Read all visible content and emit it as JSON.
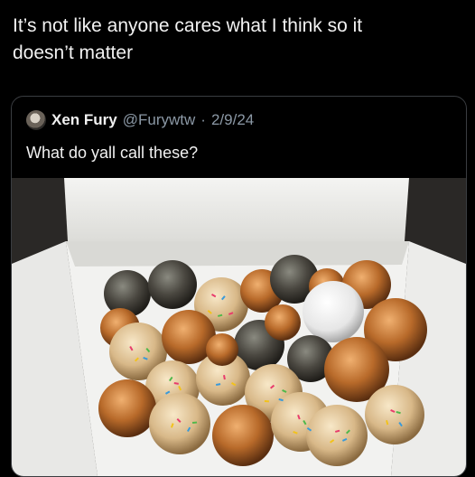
{
  "post": {
    "text": "It’s not like anyone cares what I think so it\ndoesn’t matter"
  },
  "quote": {
    "display_name": "Xen Fury",
    "handle": "@Furywtw",
    "separator": "·",
    "date": "2/9/24",
    "text": "What do yall call these?"
  },
  "media": {
    "description_icon": "donut-holes-photo"
  },
  "colors": {
    "background": "#000000",
    "text": "#f2f2f2",
    "muted": "#8b98a5",
    "border": "#3a3d41"
  }
}
